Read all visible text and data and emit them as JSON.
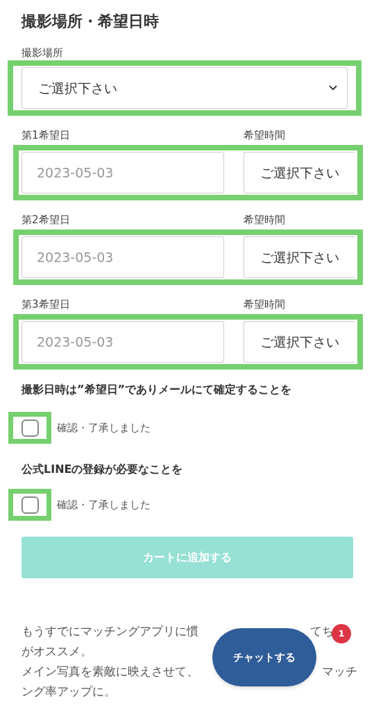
{
  "title": "撮影場所・希望日時",
  "location": {
    "label": "撮影場所",
    "placeholder": "ご選択下さい"
  },
  "date_rows": [
    {
      "date_label": "第1希望日",
      "date_placeholder": "2023-05-03",
      "time_label": "希望時間",
      "time_placeholder": "ご選択下さい"
    },
    {
      "date_label": "第2希望日",
      "date_placeholder": "2023-05-03",
      "time_label": "希望時間",
      "time_placeholder": "ご選択下さい"
    },
    {
      "date_label": "第3希望日",
      "date_placeholder": "2023-05-03",
      "time_label": "希望時間",
      "time_placeholder": "ご選択下さい"
    }
  ],
  "confirmations": [
    {
      "heading": "撮影日時は”希望日”でありメールにて確定することを",
      "label": "確認・了承しました",
      "checked": false
    },
    {
      "heading": "公式LINEの登録が必要なことを",
      "label": "確認・了承しました",
      "checked": false
    }
  ],
  "cart_button": {
    "label": "カートに追加する",
    "disabled": true
  },
  "description_lines": [
    [
      "もうすでにマッチングアプリに慣",
      "てち"
    ],
    [
      "がオススメ。"
    ],
    [
      "メイン写真を素敵に映えさせて、",
      "マッチ"
    ],
    [
      "ング率アップに。"
    ]
  ],
  "chat_button": {
    "label": "チャットする",
    "badge": "1"
  }
}
